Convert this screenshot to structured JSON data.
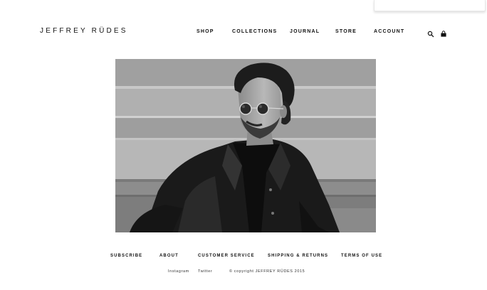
{
  "brand": {
    "name": "JEFFREY RÜDES"
  },
  "nav": {
    "items": [
      {
        "label": "SHOP"
      },
      {
        "label": "COLLECTIONS"
      },
      {
        "label": "JOURNAL"
      },
      {
        "label": "STORE"
      },
      {
        "label": "ACCOUNT"
      }
    ],
    "icons": [
      "search-icon",
      "shopping-bag-icon"
    ]
  },
  "hero": {
    "alt": "Black and white photo of a man in round sunglasses and a dark jacket sitting on stone steps"
  },
  "footer": {
    "links": [
      {
        "label": "SUBSCRIBE"
      },
      {
        "label": "ABOUT"
      },
      {
        "label": "CUSTOMER SERVICE"
      },
      {
        "label": "SHIPPING & RETURNS"
      },
      {
        "label": "TERMS OF USE"
      }
    ],
    "social": [
      {
        "label": "Instagram"
      },
      {
        "label": "Twitter"
      }
    ],
    "copyright": "© copyright JEFFREY RÜDES 2015"
  }
}
